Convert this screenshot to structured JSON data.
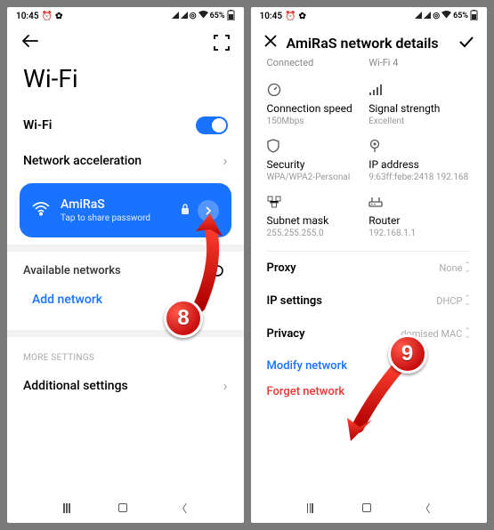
{
  "status": {
    "time": "10:45",
    "battery": "65%"
  },
  "left": {
    "title": "Wi-Fi",
    "wifi_label": "Wi-Fi",
    "net_accel": "Network acceleration",
    "connected": {
      "name": "AmiRaS",
      "sub": "Tap to share password"
    },
    "available": "Available networks",
    "add": "Add network",
    "more": "MORE SETTINGS",
    "additional": "Additional settings"
  },
  "right": {
    "title": "AmiRaS network details",
    "status_connected": "Connected",
    "status_wifi": "Wi-Fi 4",
    "cells": {
      "speed_lbl": "Connection speed",
      "speed_val": "150Mbps",
      "signal_lbl": "Signal strength",
      "signal_val": "Excellent",
      "security_lbl": "Security",
      "security_val": "WPA/WPA2-Personal",
      "ip_lbl": "IP address",
      "ip_val": "9:63ff:febe:2418 192.168",
      "subnet_lbl": "Subnet mask",
      "subnet_val": "255.255.255.0",
      "router_lbl": "Router",
      "router_val": "192.168.1.1"
    },
    "proxy": "Proxy",
    "proxy_val": "None",
    "ipset": "IP settings",
    "ipset_val": "DHCP",
    "privacy": "Privacy",
    "privacy_val": "domised MAC",
    "modify": "Modify network",
    "forget": "Forget network"
  },
  "badges": {
    "b8": "8",
    "b9": "9"
  }
}
